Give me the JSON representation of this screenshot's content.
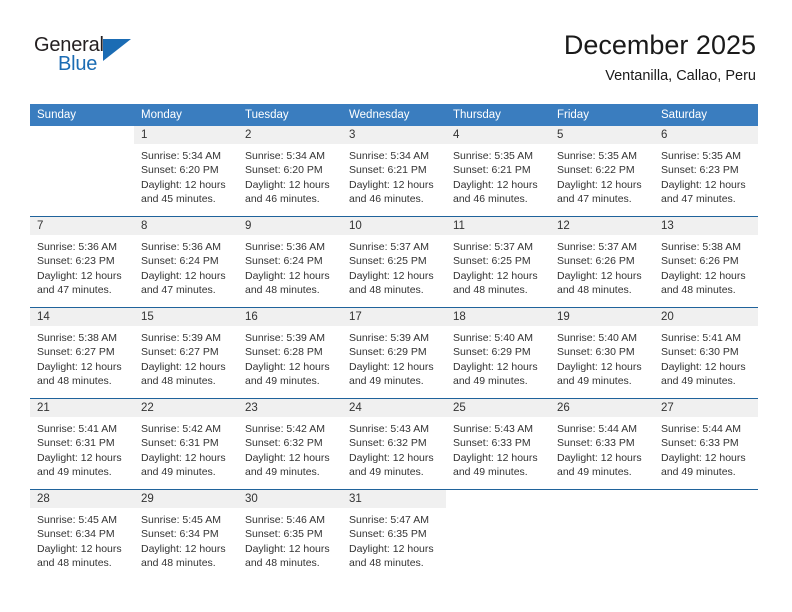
{
  "brand": {
    "name_top": "General",
    "name_bottom": "Blue",
    "accent_color": "#1b6cb4"
  },
  "header": {
    "title": "December 2025",
    "subtitle": "Ventanilla, Callao, Peru"
  },
  "colors": {
    "header_row_bg": "#3a7dbf",
    "week_separator": "#20639b",
    "daynum_band_bg": "#f0f0f0",
    "text": "#333333"
  },
  "labels": {
    "sunrise_prefix": "Sunrise:",
    "sunset_prefix": "Sunset:",
    "daylight_prefix": "Daylight:"
  },
  "weekday_headers": [
    "Sunday",
    "Monday",
    "Tuesday",
    "Wednesday",
    "Thursday",
    "Friday",
    "Saturday"
  ],
  "weeks": [
    [
      {
        "day": "",
        "empty": true,
        "sunrise": "",
        "sunset": "",
        "daylight_l1": "",
        "daylight_l2": ""
      },
      {
        "day": "1",
        "empty": false,
        "sunrise": "Sunrise: 5:34 AM",
        "sunset": "Sunset: 6:20 PM",
        "daylight_l1": "Daylight: 12 hours",
        "daylight_l2": "and 45 minutes."
      },
      {
        "day": "2",
        "empty": false,
        "sunrise": "Sunrise: 5:34 AM",
        "sunset": "Sunset: 6:20 PM",
        "daylight_l1": "Daylight: 12 hours",
        "daylight_l2": "and 46 minutes."
      },
      {
        "day": "3",
        "empty": false,
        "sunrise": "Sunrise: 5:34 AM",
        "sunset": "Sunset: 6:21 PM",
        "daylight_l1": "Daylight: 12 hours",
        "daylight_l2": "and 46 minutes."
      },
      {
        "day": "4",
        "empty": false,
        "sunrise": "Sunrise: 5:35 AM",
        "sunset": "Sunset: 6:21 PM",
        "daylight_l1": "Daylight: 12 hours",
        "daylight_l2": "and 46 minutes."
      },
      {
        "day": "5",
        "empty": false,
        "sunrise": "Sunrise: 5:35 AM",
        "sunset": "Sunset: 6:22 PM",
        "daylight_l1": "Daylight: 12 hours",
        "daylight_l2": "and 47 minutes."
      },
      {
        "day": "6",
        "empty": false,
        "sunrise": "Sunrise: 5:35 AM",
        "sunset": "Sunset: 6:23 PM",
        "daylight_l1": "Daylight: 12 hours",
        "daylight_l2": "and 47 minutes."
      }
    ],
    [
      {
        "day": "7",
        "empty": false,
        "sunrise": "Sunrise: 5:36 AM",
        "sunset": "Sunset: 6:23 PM",
        "daylight_l1": "Daylight: 12 hours",
        "daylight_l2": "and 47 minutes."
      },
      {
        "day": "8",
        "empty": false,
        "sunrise": "Sunrise: 5:36 AM",
        "sunset": "Sunset: 6:24 PM",
        "daylight_l1": "Daylight: 12 hours",
        "daylight_l2": "and 47 minutes."
      },
      {
        "day": "9",
        "empty": false,
        "sunrise": "Sunrise: 5:36 AM",
        "sunset": "Sunset: 6:24 PM",
        "daylight_l1": "Daylight: 12 hours",
        "daylight_l2": "and 48 minutes."
      },
      {
        "day": "10",
        "empty": false,
        "sunrise": "Sunrise: 5:37 AM",
        "sunset": "Sunset: 6:25 PM",
        "daylight_l1": "Daylight: 12 hours",
        "daylight_l2": "and 48 minutes."
      },
      {
        "day": "11",
        "empty": false,
        "sunrise": "Sunrise: 5:37 AM",
        "sunset": "Sunset: 6:25 PM",
        "daylight_l1": "Daylight: 12 hours",
        "daylight_l2": "and 48 minutes."
      },
      {
        "day": "12",
        "empty": false,
        "sunrise": "Sunrise: 5:37 AM",
        "sunset": "Sunset: 6:26 PM",
        "daylight_l1": "Daylight: 12 hours",
        "daylight_l2": "and 48 minutes."
      },
      {
        "day": "13",
        "empty": false,
        "sunrise": "Sunrise: 5:38 AM",
        "sunset": "Sunset: 6:26 PM",
        "daylight_l1": "Daylight: 12 hours",
        "daylight_l2": "and 48 minutes."
      }
    ],
    [
      {
        "day": "14",
        "empty": false,
        "sunrise": "Sunrise: 5:38 AM",
        "sunset": "Sunset: 6:27 PM",
        "daylight_l1": "Daylight: 12 hours",
        "daylight_l2": "and 48 minutes."
      },
      {
        "day": "15",
        "empty": false,
        "sunrise": "Sunrise: 5:39 AM",
        "sunset": "Sunset: 6:27 PM",
        "daylight_l1": "Daylight: 12 hours",
        "daylight_l2": "and 48 minutes."
      },
      {
        "day": "16",
        "empty": false,
        "sunrise": "Sunrise: 5:39 AM",
        "sunset": "Sunset: 6:28 PM",
        "daylight_l1": "Daylight: 12 hours",
        "daylight_l2": "and 49 minutes."
      },
      {
        "day": "17",
        "empty": false,
        "sunrise": "Sunrise: 5:39 AM",
        "sunset": "Sunset: 6:29 PM",
        "daylight_l1": "Daylight: 12 hours",
        "daylight_l2": "and 49 minutes."
      },
      {
        "day": "18",
        "empty": false,
        "sunrise": "Sunrise: 5:40 AM",
        "sunset": "Sunset: 6:29 PM",
        "daylight_l1": "Daylight: 12 hours",
        "daylight_l2": "and 49 minutes."
      },
      {
        "day": "19",
        "empty": false,
        "sunrise": "Sunrise: 5:40 AM",
        "sunset": "Sunset: 6:30 PM",
        "daylight_l1": "Daylight: 12 hours",
        "daylight_l2": "and 49 minutes."
      },
      {
        "day": "20",
        "empty": false,
        "sunrise": "Sunrise: 5:41 AM",
        "sunset": "Sunset: 6:30 PM",
        "daylight_l1": "Daylight: 12 hours",
        "daylight_l2": "and 49 minutes."
      }
    ],
    [
      {
        "day": "21",
        "empty": false,
        "sunrise": "Sunrise: 5:41 AM",
        "sunset": "Sunset: 6:31 PM",
        "daylight_l1": "Daylight: 12 hours",
        "daylight_l2": "and 49 minutes."
      },
      {
        "day": "22",
        "empty": false,
        "sunrise": "Sunrise: 5:42 AM",
        "sunset": "Sunset: 6:31 PM",
        "daylight_l1": "Daylight: 12 hours",
        "daylight_l2": "and 49 minutes."
      },
      {
        "day": "23",
        "empty": false,
        "sunrise": "Sunrise: 5:42 AM",
        "sunset": "Sunset: 6:32 PM",
        "daylight_l1": "Daylight: 12 hours",
        "daylight_l2": "and 49 minutes."
      },
      {
        "day": "24",
        "empty": false,
        "sunrise": "Sunrise: 5:43 AM",
        "sunset": "Sunset: 6:32 PM",
        "daylight_l1": "Daylight: 12 hours",
        "daylight_l2": "and 49 minutes."
      },
      {
        "day": "25",
        "empty": false,
        "sunrise": "Sunrise: 5:43 AM",
        "sunset": "Sunset: 6:33 PM",
        "daylight_l1": "Daylight: 12 hours",
        "daylight_l2": "and 49 minutes."
      },
      {
        "day": "26",
        "empty": false,
        "sunrise": "Sunrise: 5:44 AM",
        "sunset": "Sunset: 6:33 PM",
        "daylight_l1": "Daylight: 12 hours",
        "daylight_l2": "and 49 minutes."
      },
      {
        "day": "27",
        "empty": false,
        "sunrise": "Sunrise: 5:44 AM",
        "sunset": "Sunset: 6:33 PM",
        "daylight_l1": "Daylight: 12 hours",
        "daylight_l2": "and 49 minutes."
      }
    ],
    [
      {
        "day": "28",
        "empty": false,
        "sunrise": "Sunrise: 5:45 AM",
        "sunset": "Sunset: 6:34 PM",
        "daylight_l1": "Daylight: 12 hours",
        "daylight_l2": "and 48 minutes."
      },
      {
        "day": "29",
        "empty": false,
        "sunrise": "Sunrise: 5:45 AM",
        "sunset": "Sunset: 6:34 PM",
        "daylight_l1": "Daylight: 12 hours",
        "daylight_l2": "and 48 minutes."
      },
      {
        "day": "30",
        "empty": false,
        "sunrise": "Sunrise: 5:46 AM",
        "sunset": "Sunset: 6:35 PM",
        "daylight_l1": "Daylight: 12 hours",
        "daylight_l2": "and 48 minutes."
      },
      {
        "day": "31",
        "empty": false,
        "sunrise": "Sunrise: 5:47 AM",
        "sunset": "Sunset: 6:35 PM",
        "daylight_l1": "Daylight: 12 hours",
        "daylight_l2": "and 48 minutes."
      },
      {
        "day": "",
        "empty": true,
        "sunrise": "",
        "sunset": "",
        "daylight_l1": "",
        "daylight_l2": ""
      },
      {
        "day": "",
        "empty": true,
        "sunrise": "",
        "sunset": "",
        "daylight_l1": "",
        "daylight_l2": ""
      },
      {
        "day": "",
        "empty": true,
        "sunrise": "",
        "sunset": "",
        "daylight_l1": "",
        "daylight_l2": ""
      }
    ]
  ]
}
